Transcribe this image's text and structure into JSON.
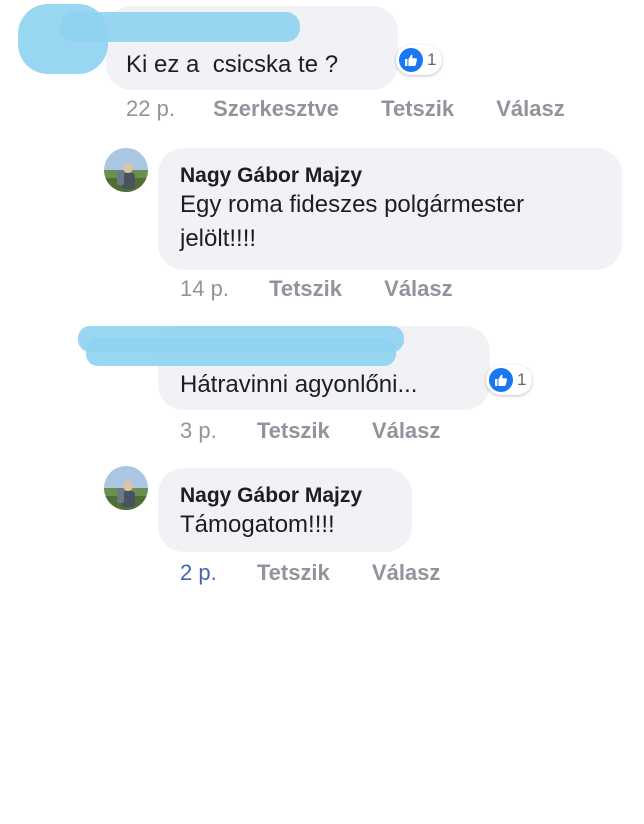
{
  "comments": [
    {
      "author": "",
      "text": "Ki ez a  csicska te ?",
      "reaction_count": "1",
      "time": "22 p.",
      "edited": "Szerkesztve",
      "like": "Tetszik",
      "reply": "Válasz"
    },
    {
      "author": "Nagy Gábor Majzy",
      "text": "Egy roma fideszes polgármester jelölt!!!!",
      "time": "14 p.",
      "like": "Tetszik",
      "reply": "Válasz"
    },
    {
      "author": "",
      "text": "Hátravinni agyonlőni...",
      "reaction_count": "1",
      "time": "3 p.",
      "like": "Tetszik",
      "reply": "Válasz"
    },
    {
      "author": "Nagy Gábor Majzy",
      "text": "Támogatom!!!!",
      "time": "2 p.",
      "like": "Tetszik",
      "reply": "Válasz"
    }
  ],
  "colors": {
    "bubble": "#f0f2f5",
    "meta": "#90949c",
    "link_time": "#4267b2",
    "like_blue": "#1877f2",
    "redaction": "#8fd3f0"
  },
  "icons": {
    "like": "thumbs-up-icon",
    "avatar": "user-avatar-photo"
  }
}
